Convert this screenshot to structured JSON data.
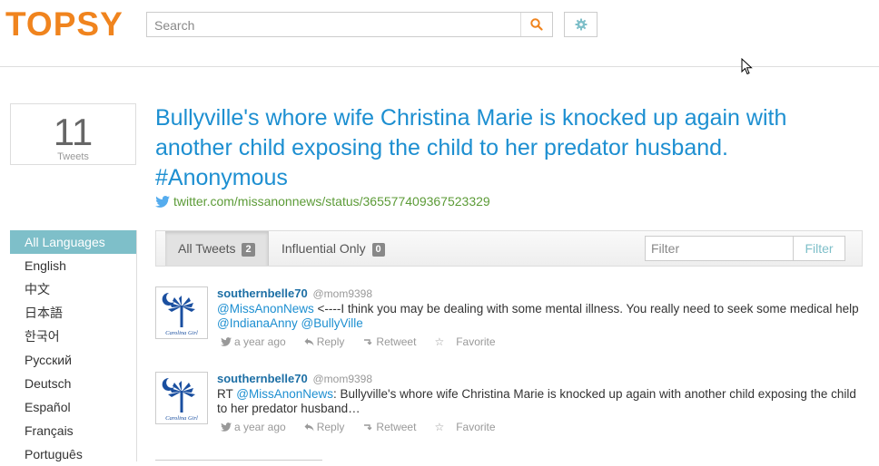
{
  "header": {
    "logo": "TOPSY",
    "search_placeholder": "Search"
  },
  "count": {
    "number": "11",
    "label": "Tweets"
  },
  "post": {
    "title": "Bullyville's whore wife Christina Marie is knocked up again with another child exposing the child to her predator husband. #Anonymous",
    "link": "twitter.com/missanonnews/status/365577409367523329"
  },
  "languages": [
    {
      "label": "All Languages"
    },
    {
      "label": "English"
    },
    {
      "label": "中文"
    },
    {
      "label": "日本語"
    },
    {
      "label": "한국어"
    },
    {
      "label": "Русский"
    },
    {
      "label": "Deutsch"
    },
    {
      "label": "Español"
    },
    {
      "label": "Français"
    },
    {
      "label": "Português"
    }
  ],
  "tabs": {
    "all": {
      "label": "All Tweets",
      "count": "2"
    },
    "influential": {
      "label": "Influential Only",
      "count": "0"
    },
    "filter_placeholder": "Filter",
    "filter_button": "Filter"
  },
  "tweets": [
    {
      "user": "southernbelle70",
      "handle": "@mom9398",
      "mention1": "@MissAnonNews",
      "text1": " <----I think you may be dealing with some mental illness. You really need to seek some medical help ",
      "mention2": "@IndianaAnny",
      "mention3": "@BullyVille",
      "time": "a year ago",
      "reply": "Reply",
      "retweet": "Retweet",
      "favorite": "Favorite",
      "avatar_text": "Carolina Girl"
    },
    {
      "user": "southernbelle70",
      "handle": "@mom9398",
      "prefix": "RT ",
      "mention1": "@MissAnonNews",
      "text1": ": Bullyville's whore wife Christina Marie is knocked up again with another child exposing the child to her predator husband…",
      "time": "a year ago",
      "reply": "Reply",
      "retweet": "Retweet",
      "favorite": "Favorite",
      "avatar_text": "Carolina Girl"
    }
  ],
  "colors": {
    "brand": "#f0841e",
    "link": "#1d8fd1",
    "accent": "#7ebfc9",
    "url": "#5c9b37"
  }
}
